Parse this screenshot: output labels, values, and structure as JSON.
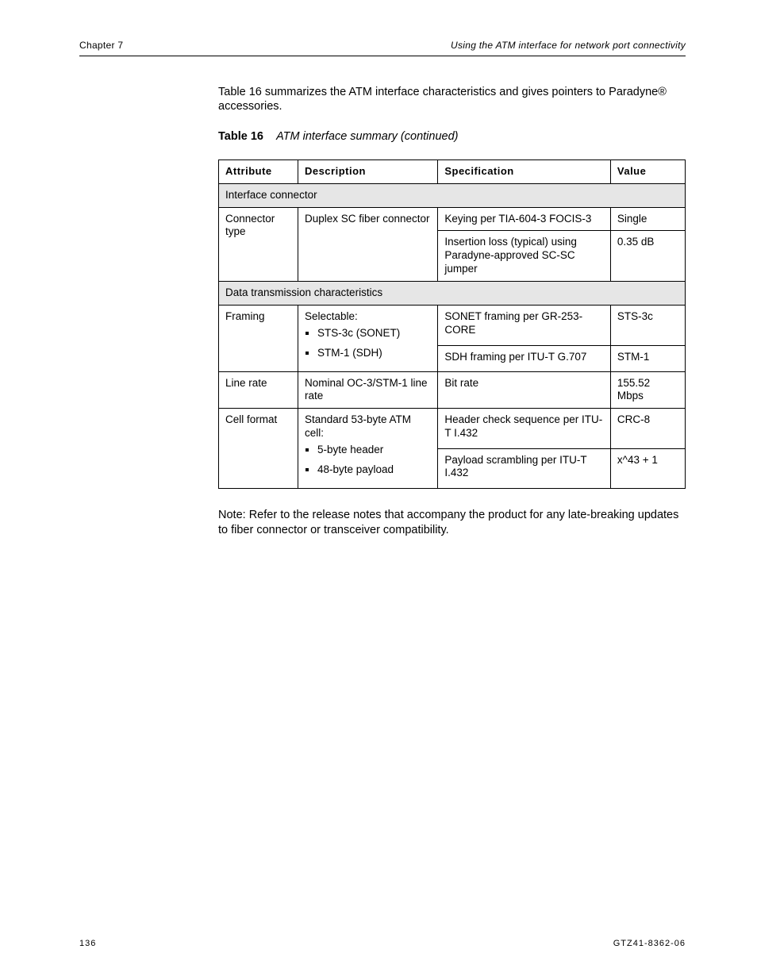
{
  "header": {
    "left": "Chapter 7",
    "right": "Using the ATM interface for network port connectivity"
  },
  "intro": "Table 16 summarizes the ATM interface characteristics and gives pointers to Paradyne® accessories.",
  "table": {
    "title_prefix": "Table 16",
    "title_rest": "ATM interface summary (continued)",
    "headers": [
      "Attribute",
      "Description",
      "Specification",
      "Value"
    ],
    "sections": [
      {
        "label": "Interface connector",
        "rows": [
          {
            "attr": "Connector type",
            "desc": "Duplex SC fiber connector",
            "specs": [
              {
                "spec": "Keying per TIA-604-3 FOCIS-3",
                "value": "Single"
              },
              {
                "spec": "Insertion loss (typical) using Paradyne-approved SC-SC jumper",
                "value": "0.35 dB"
              }
            ]
          }
        ]
      },
      {
        "label": "Data transmission characteristics",
        "rows": [
          {
            "attr": "Framing",
            "desc_bullets": [
              "STS-3c (SONET)",
              "STM-1 (SDH)"
            ],
            "desc_prefix": "Selectable:",
            "specs": [
              {
                "spec": "SONET framing per GR-253-CORE",
                "value": "STS-3c"
              },
              {
                "spec": "SDH framing per ITU-T G.707",
                "value": "STM-1"
              }
            ]
          },
          {
            "attr": "Line rate",
            "desc": "Nominal OC-3/STM-1 line rate",
            "specs": [
              {
                "spec": "Bit rate",
                "value": "155.52 Mbps"
              }
            ]
          },
          {
            "attr": "Cell format",
            "desc_prefix": "Standard 53-byte ATM cell:",
            "desc_bullets": [
              "5-byte header",
              "48-byte payload"
            ],
            "specs": [
              {
                "spec": "Header check sequence per ITU-T I.432",
                "value": "CRC-8"
              },
              {
                "spec": "Payload scrambling per ITU-T I.432",
                "value": "x^43 + 1"
              }
            ]
          }
        ]
      }
    ]
  },
  "note": {
    "label": "Note:",
    "text": "Refer to the release notes that accompany the product for any late-breaking updates to fiber connector or transceiver compatibility."
  },
  "footer": {
    "page": "136",
    "doc": "GTZ41-8362-06"
  }
}
